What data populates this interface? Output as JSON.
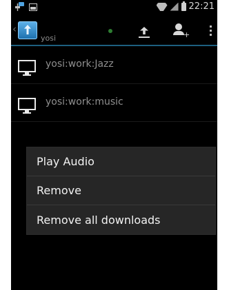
{
  "status_bar": {
    "time": "22:21",
    "icons": [
      "usb-icon",
      "image-icon",
      "wifi-icon",
      "signal-icon",
      "battery-icon"
    ]
  },
  "action_bar": {
    "title": "yosi",
    "back_glyph": "‹",
    "icons": [
      "app-icon",
      "status-dot-icon",
      "upload-icon",
      "add-user-icon",
      "overflow-menu-icon"
    ],
    "status_dot_color": "#2e7d32",
    "accent": "#1d5f80"
  },
  "list": {
    "items": [
      {
        "label": "yosi:work:Jazz",
        "icon": "monitor-icon"
      },
      {
        "label": "yosi:work:music",
        "icon": "monitor-icon"
      }
    ]
  },
  "context_menu": {
    "items": [
      {
        "label": "Play Audio"
      },
      {
        "label": "Remove"
      },
      {
        "label": "Remove all downloads"
      }
    ]
  }
}
